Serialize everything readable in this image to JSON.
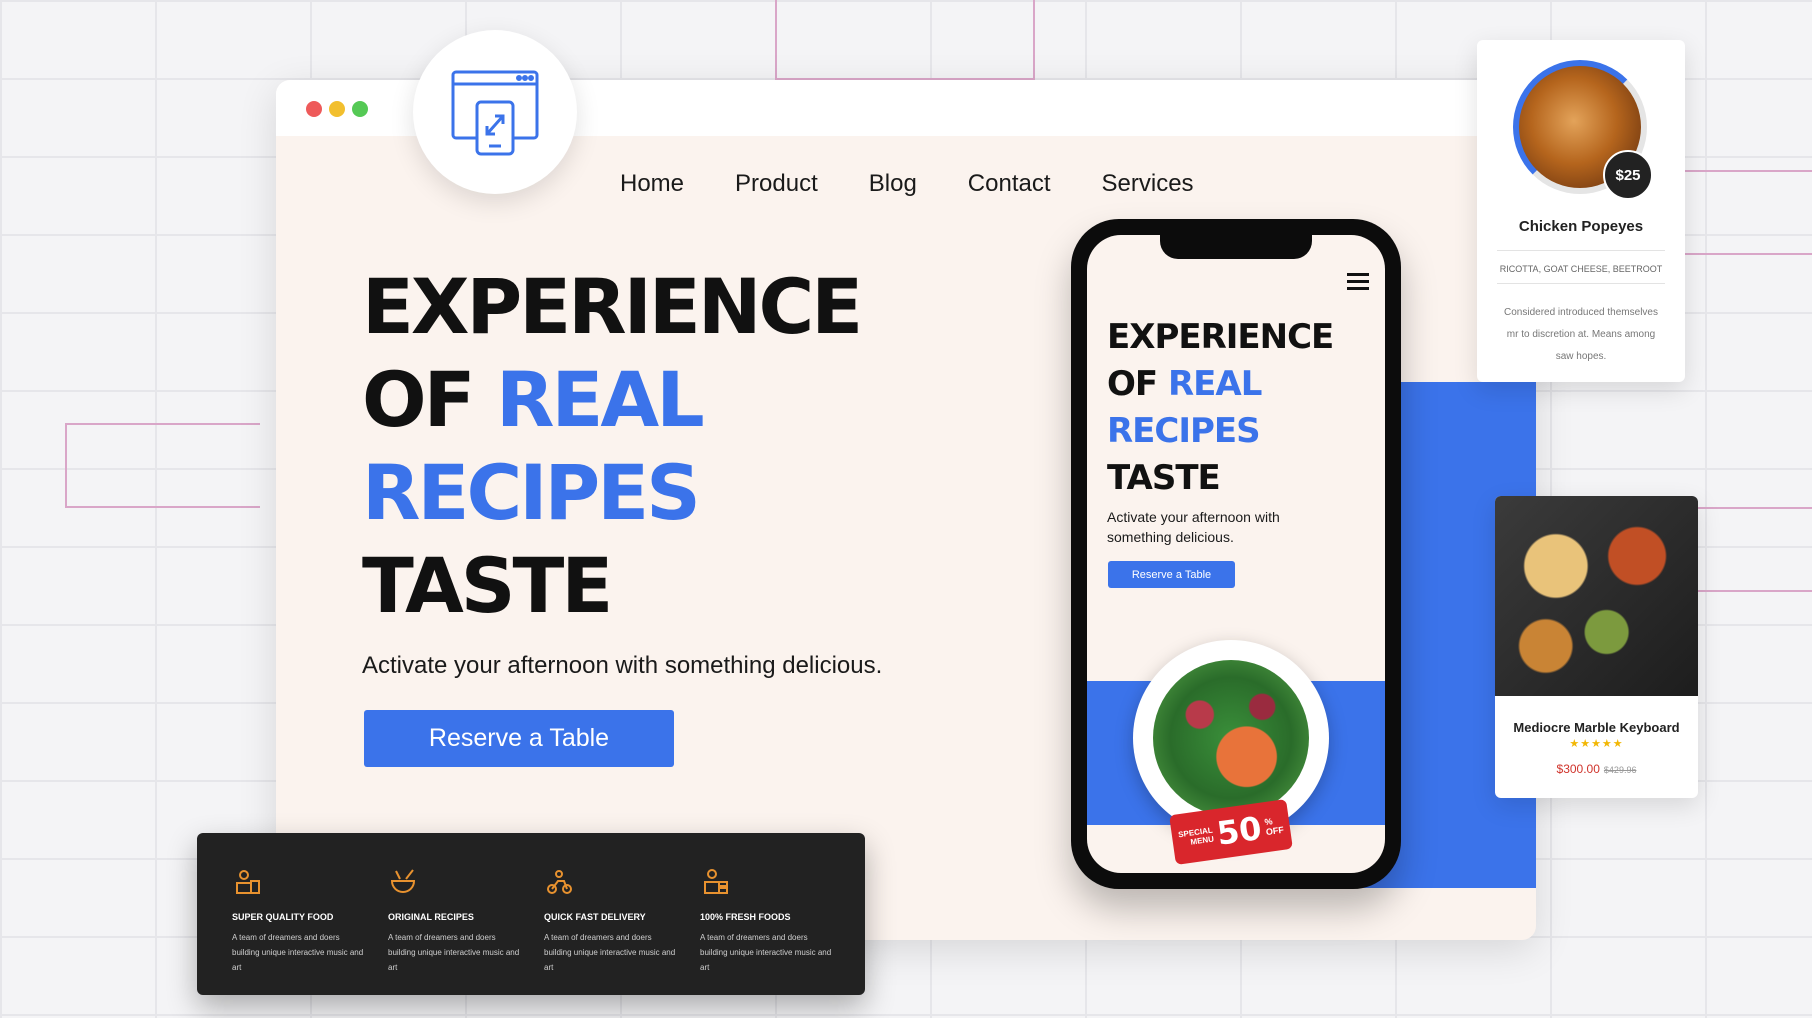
{
  "nav": {
    "items": [
      "Home",
      "Product",
      "Blog",
      "Contact",
      "Services"
    ]
  },
  "hero": {
    "title_line1": "EXPERIENCE",
    "title_line2_a": "OF ",
    "title_line2_b": "REAL",
    "title_line3": "RECIPES",
    "title_line4": "TASTE",
    "subtitle": "Activate your afternoon with something delicious.",
    "cta_label": "Reserve a Table"
  },
  "phone": {
    "title_line1": "EXPERIENCE",
    "title_line2_a": "OF ",
    "title_line2_b": "REAL",
    "title_line3": "RECIPES",
    "title_line4": "TASTE",
    "subtitle": "Activate your afternoon with something delicious.",
    "cta_label": "Reserve a Table",
    "special_label_1": "SPECIAL",
    "special_label_2": "MENU",
    "special_percent": "50",
    "special_pct_sign": "%",
    "special_off": "OFF"
  },
  "features": [
    {
      "icon": "chef-icon",
      "title": "SUPER QUALITY FOOD",
      "desc": "A team of dreamers and doers building unique interactive music and art"
    },
    {
      "icon": "bowl-icon",
      "title": "ORIGINAL RECIPES",
      "desc": "A team of dreamers and doers building unique interactive music and art"
    },
    {
      "icon": "delivery-icon",
      "title": "QUICK FAST DELIVERY",
      "desc": "A team of dreamers and doers building unique interactive music and art"
    },
    {
      "icon": "burger-icon",
      "title": "100% FRESH FOODS",
      "desc": "A team of dreamers and doers building unique interactive music and art"
    }
  ],
  "card1": {
    "price": "$25",
    "title": "Chicken Popeyes",
    "ingredients": "RICOTTA, GOAT CHEESE, BEETROOT",
    "desc": "Considered introduced themselves mr to discretion at. Means among saw hopes."
  },
  "card2": {
    "title": "Mediocre Marble Keyboard",
    "stars": "★★★★★",
    "price": "$300.00",
    "old_price": "$429.96"
  },
  "colors": {
    "accent": "#3b73ea",
    "dark": "#222222",
    "page_bg": "#fbf3ee",
    "sale_red": "#d9262c"
  }
}
